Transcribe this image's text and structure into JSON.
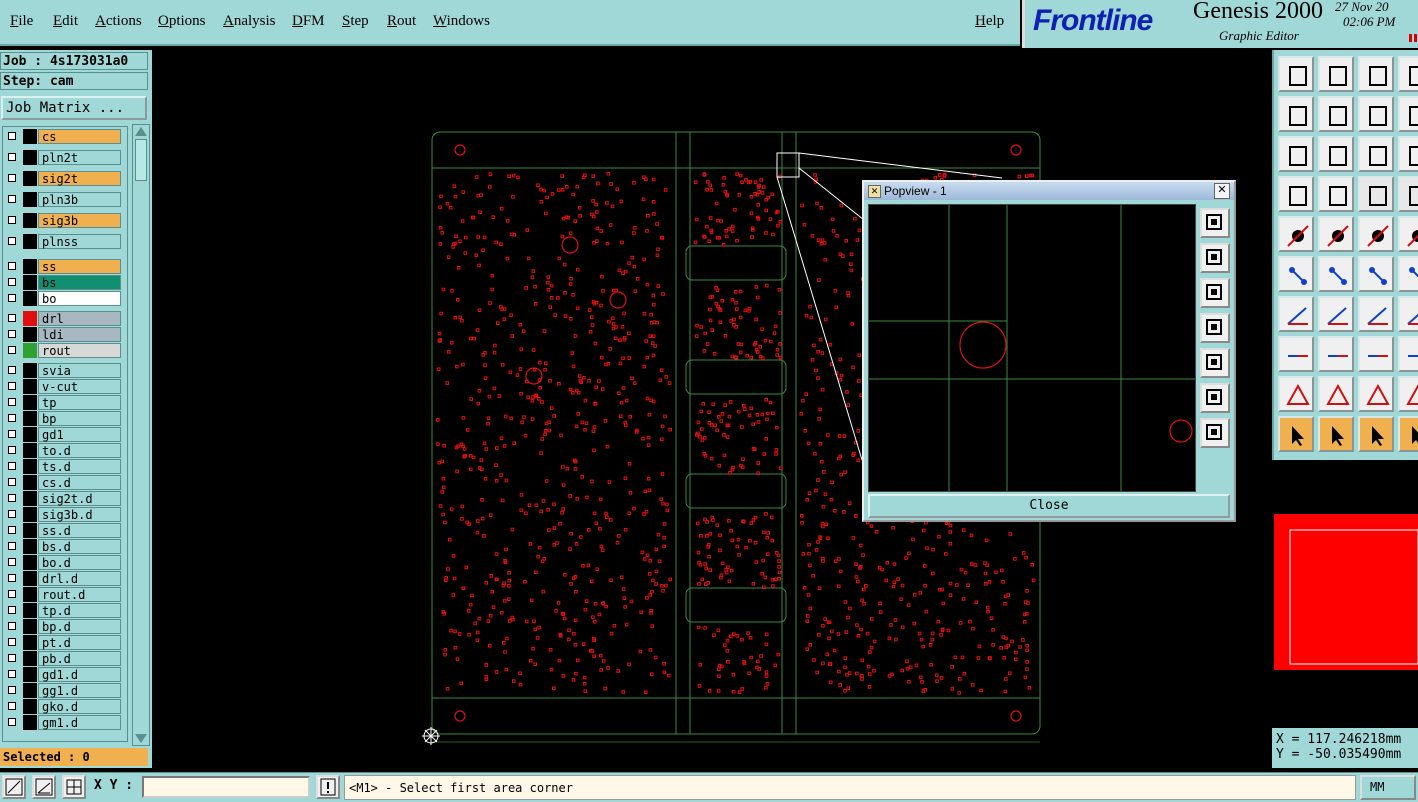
{
  "menu": {
    "items": [
      "File",
      "Edit",
      "Actions",
      "Options",
      "Analysis",
      "DFM",
      "Step",
      "Rout",
      "Windows"
    ],
    "help": "Help"
  },
  "brand": {
    "logo": "Frontline",
    "product": "Genesis 2000",
    "subtitle": "Graphic Editor",
    "date": "27 Nov 20",
    "time": "02:06 PM"
  },
  "left": {
    "job": "Job : 4s173031a0",
    "step": "Step: cam",
    "job_matrix": "Job Matrix ...",
    "selected": "Selected : 0"
  },
  "layers": [
    {
      "name": "cs",
      "bg": "#f0b050",
      "sw": "#000000"
    },
    {
      "name": "pln2t",
      "bg": "#9fd8d6",
      "sw": "#000000"
    },
    {
      "name": "sig2t",
      "bg": "#f0b050",
      "sw": "#000000"
    },
    {
      "name": "pln3b",
      "bg": "#9fd8d6",
      "sw": "#000000"
    },
    {
      "name": "sig3b",
      "bg": "#f0b050",
      "sw": "#000000"
    },
    {
      "name": "plnss",
      "bg": "#9fd8d6",
      "sw": "#000000"
    },
    {
      "name": "ss",
      "bg": "#f0b050",
      "sw": "#000000"
    },
    {
      "name": "bs",
      "bg": "#109070",
      "sw": "#000000"
    },
    {
      "name": "bo",
      "bg": "#ffffff",
      "sw": "#000000"
    },
    {
      "name": "drl",
      "bg": "#a8b8c0",
      "sw": "#e01010"
    },
    {
      "name": "ldi",
      "bg": "#a8b8c0",
      "sw": "#000000"
    },
    {
      "name": "rout",
      "bg": "#d8d8d8",
      "sw": "#30a030"
    },
    {
      "name": "svia",
      "bg": "#9fd8d6",
      "sw": "#000000"
    },
    {
      "name": "v-cut",
      "bg": "#9fd8d6",
      "sw": "#000000"
    },
    {
      "name": "tp",
      "bg": "#9fd8d6",
      "sw": "#000000"
    },
    {
      "name": "bp",
      "bg": "#9fd8d6",
      "sw": "#000000"
    },
    {
      "name": "gd1",
      "bg": "#9fd8d6",
      "sw": "#000000"
    },
    {
      "name": "to.d",
      "bg": "#9fd8d6",
      "sw": "#000000"
    },
    {
      "name": "ts.d",
      "bg": "#9fd8d6",
      "sw": "#000000"
    },
    {
      "name": "cs.d",
      "bg": "#9fd8d6",
      "sw": "#000000"
    },
    {
      "name": "sig2t.d",
      "bg": "#9fd8d6",
      "sw": "#000000"
    },
    {
      "name": "sig3b.d",
      "bg": "#9fd8d6",
      "sw": "#000000"
    },
    {
      "name": "ss.d",
      "bg": "#9fd8d6",
      "sw": "#000000"
    },
    {
      "name": "bs.d",
      "bg": "#9fd8d6",
      "sw": "#000000"
    },
    {
      "name": "bo.d",
      "bg": "#9fd8d6",
      "sw": "#000000"
    },
    {
      "name": "drl.d",
      "bg": "#9fd8d6",
      "sw": "#000000"
    },
    {
      "name": "rout.d",
      "bg": "#9fd8d6",
      "sw": "#000000"
    },
    {
      "name": "tp.d",
      "bg": "#9fd8d6",
      "sw": "#000000"
    },
    {
      "name": "bp.d",
      "bg": "#9fd8d6",
      "sw": "#000000"
    },
    {
      "name": "pt.d",
      "bg": "#9fd8d6",
      "sw": "#000000"
    },
    {
      "name": "pb.d",
      "bg": "#9fd8d6",
      "sw": "#000000"
    },
    {
      "name": "gd1.d",
      "bg": "#9fd8d6",
      "sw": "#000000"
    },
    {
      "name": "gg1.d",
      "bg": "#9fd8d6",
      "sw": "#000000"
    },
    {
      "name": "gko.d",
      "bg": "#9fd8d6",
      "sw": "#000000"
    },
    {
      "name": "gm1.d",
      "bg": "#9fd8d6",
      "sw": "#000000"
    }
  ],
  "popview": {
    "title": "Popview - 1",
    "close_x": "✕",
    "close_button": "Close"
  },
  "coords": {
    "x": "X = 117.246218mm",
    "y": "Y = -50.035490mm"
  },
  "status": {
    "xy_label": "X Y :",
    "xy_value": "",
    "prompt": "<M1> - Select first area corner",
    "units": "MM"
  },
  "colors": {
    "panel": "#9fd8d6",
    "highlight": "#f0b050",
    "outline": "#3c8c3c",
    "pads": "#e01010"
  }
}
